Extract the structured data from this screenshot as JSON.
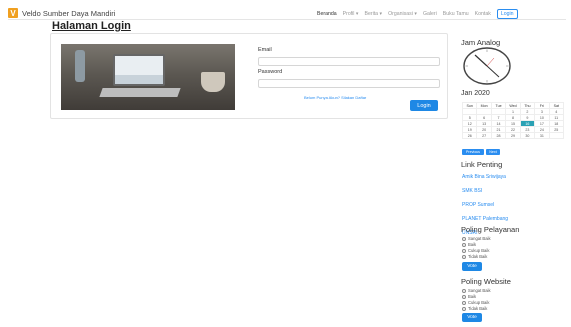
{
  "navbar": {
    "logo_letter": "V",
    "brand": "Veldo Sumber Daya Mandiri",
    "items": [
      {
        "label": "Beranda"
      },
      {
        "label": "Profil ▾"
      },
      {
        "label": "Berita ▾"
      },
      {
        "label": "Organisasi ▾"
      },
      {
        "label": "Galeri"
      },
      {
        "label": "Buku Tamu"
      },
      {
        "label": "Kontak"
      },
      {
        "label": "Login"
      }
    ]
  },
  "page": {
    "title": "Halaman Login"
  },
  "login": {
    "email_label": "Email",
    "password_label": "Password",
    "email_value": "",
    "password_value": "",
    "forgot_link": "Belum Punya Akun? Silakan Daftar",
    "login_button": "Login"
  },
  "sidebar": {
    "clock_title": "Jam Analog",
    "calendar": {
      "month_title": "Jan 2020",
      "weekdays": [
        "Sun",
        "Mon",
        "Tue",
        "Wed",
        "Thu",
        "Fri",
        "Sat"
      ],
      "weeks": [
        [
          "",
          "",
          "",
          "1",
          "2",
          "3",
          "4"
        ],
        [
          "5",
          "6",
          "7",
          "8",
          "9",
          "10",
          "11"
        ],
        [
          "12",
          "13",
          "14",
          "15",
          "16",
          "17",
          "18"
        ],
        [
          "19",
          "20",
          "21",
          "22",
          "23",
          "24",
          "25"
        ],
        [
          "26",
          "27",
          "28",
          "29",
          "30",
          "31",
          ""
        ]
      ],
      "today": "16",
      "prev_label": "Previous",
      "next_label": "Next"
    },
    "links_title": "Link Penting",
    "links": [
      "Amik Bina Sriwijaya",
      "SMK BSI",
      "PROP Sumsel",
      "PLANET Palembang",
      "UNSRI"
    ],
    "poll_service": {
      "title": "Poling Pelayanan",
      "options": [
        "Sangat Baik",
        "Baik",
        "Cukup Baik",
        "Tidak Baik"
      ],
      "vote": "Vote"
    },
    "poll_website": {
      "title": "Poling Website",
      "options": [
        "Sangat Baik",
        "Baik",
        "Cukup Baik",
        "Tidak Baik"
      ],
      "vote": "Vote"
    }
  },
  "colors": {
    "accent": "#1e88e5",
    "logo": "#f0a020",
    "today": "#2aa1b4"
  }
}
